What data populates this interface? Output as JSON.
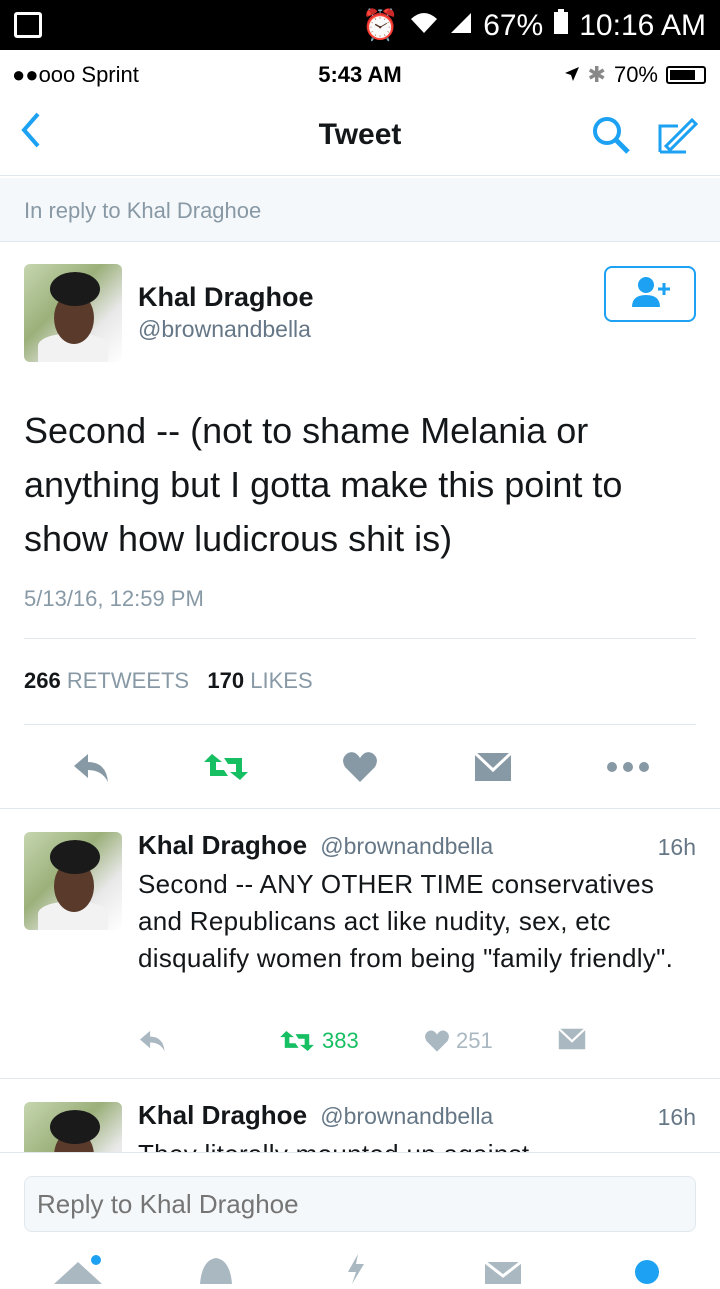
{
  "android_status": {
    "battery": "67%",
    "time": "10:16 AM"
  },
  "ios_status": {
    "carrier": "●●ooo Sprint",
    "time": "5:43 AM",
    "battery": "70%"
  },
  "nav": {
    "title": "Tweet"
  },
  "reply_banner": "In reply to Khal Draghoe",
  "main_tweet": {
    "name": "Khal Draghoe",
    "handle": "@brownandbella",
    "text": "Second -- (not to shame Melania or anything but I gotta make this point to show how ludicrous shit is)",
    "date": "5/13/16, 12:59 PM",
    "retweets_count": "266",
    "retweets_label": "RETWEETS",
    "likes_count": "170",
    "likes_label": "LIKES"
  },
  "replies": [
    {
      "name": "Khal Draghoe",
      "handle": "@brownandbella",
      "time": "16h",
      "text": "Second -- ANY OTHER TIME conservatives and Republicans act like nudity, sex, etc disqualify women from being \"family friendly\".",
      "retweets": "383",
      "likes": "251"
    },
    {
      "name": "Khal Draghoe",
      "handle": "@brownandbella",
      "time": "16h",
      "text": "They literally mounted up against"
    }
  ],
  "compose": {
    "placeholder": "Reply to Khal Draghoe"
  },
  "colors": {
    "accent": "#1da1f2",
    "retweet_green": "#17bf63",
    "muted": "#8899a6"
  }
}
